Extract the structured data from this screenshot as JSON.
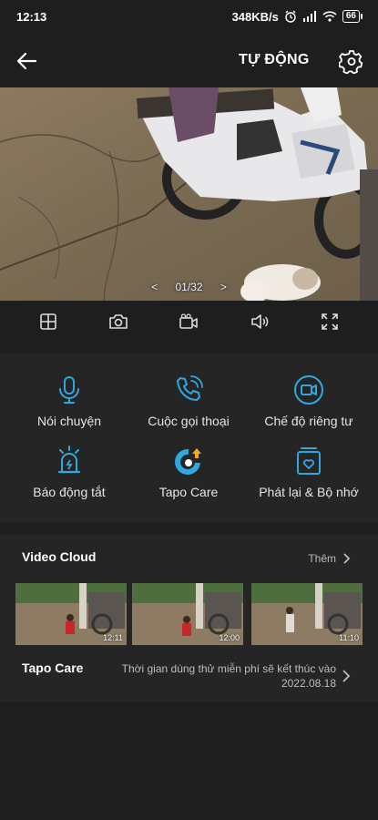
{
  "status": {
    "time": "12:13",
    "speed": "348KB/s",
    "battery": "66"
  },
  "header": {
    "title": "TỰ ĐỘNG"
  },
  "video": {
    "counter": "01/32",
    "prev": "<",
    "next": ">"
  },
  "features": [
    {
      "label": "Nói chuyện",
      "icon": "microphone-icon"
    },
    {
      "label": "Cuộc gọi thoại",
      "icon": "phone-call-icon"
    },
    {
      "label": "Chế độ riêng tư",
      "icon": "privacy-camera-icon"
    },
    {
      "label": "Báo động tắt",
      "icon": "siren-icon"
    },
    {
      "label": "Tapo Care",
      "icon": "tapo-care-icon"
    },
    {
      "label": "Phát lại & Bộ nhớ",
      "icon": "playback-storage-icon"
    }
  ],
  "cloud": {
    "title": "Video Cloud",
    "more": "Thêm",
    "thumbnails": [
      {
        "time": "12:11"
      },
      {
        "time": "12:00"
      },
      {
        "time": "11:10"
      }
    ]
  },
  "care": {
    "title": "Tapo Care",
    "line1": "Thời gian dùng thử miễn phí sẽ kết thúc vào",
    "line2": "2022.08.18"
  },
  "colors": {
    "accent": "#2fa8e0",
    "background": "#1e1e1f",
    "panel": "#252526"
  }
}
